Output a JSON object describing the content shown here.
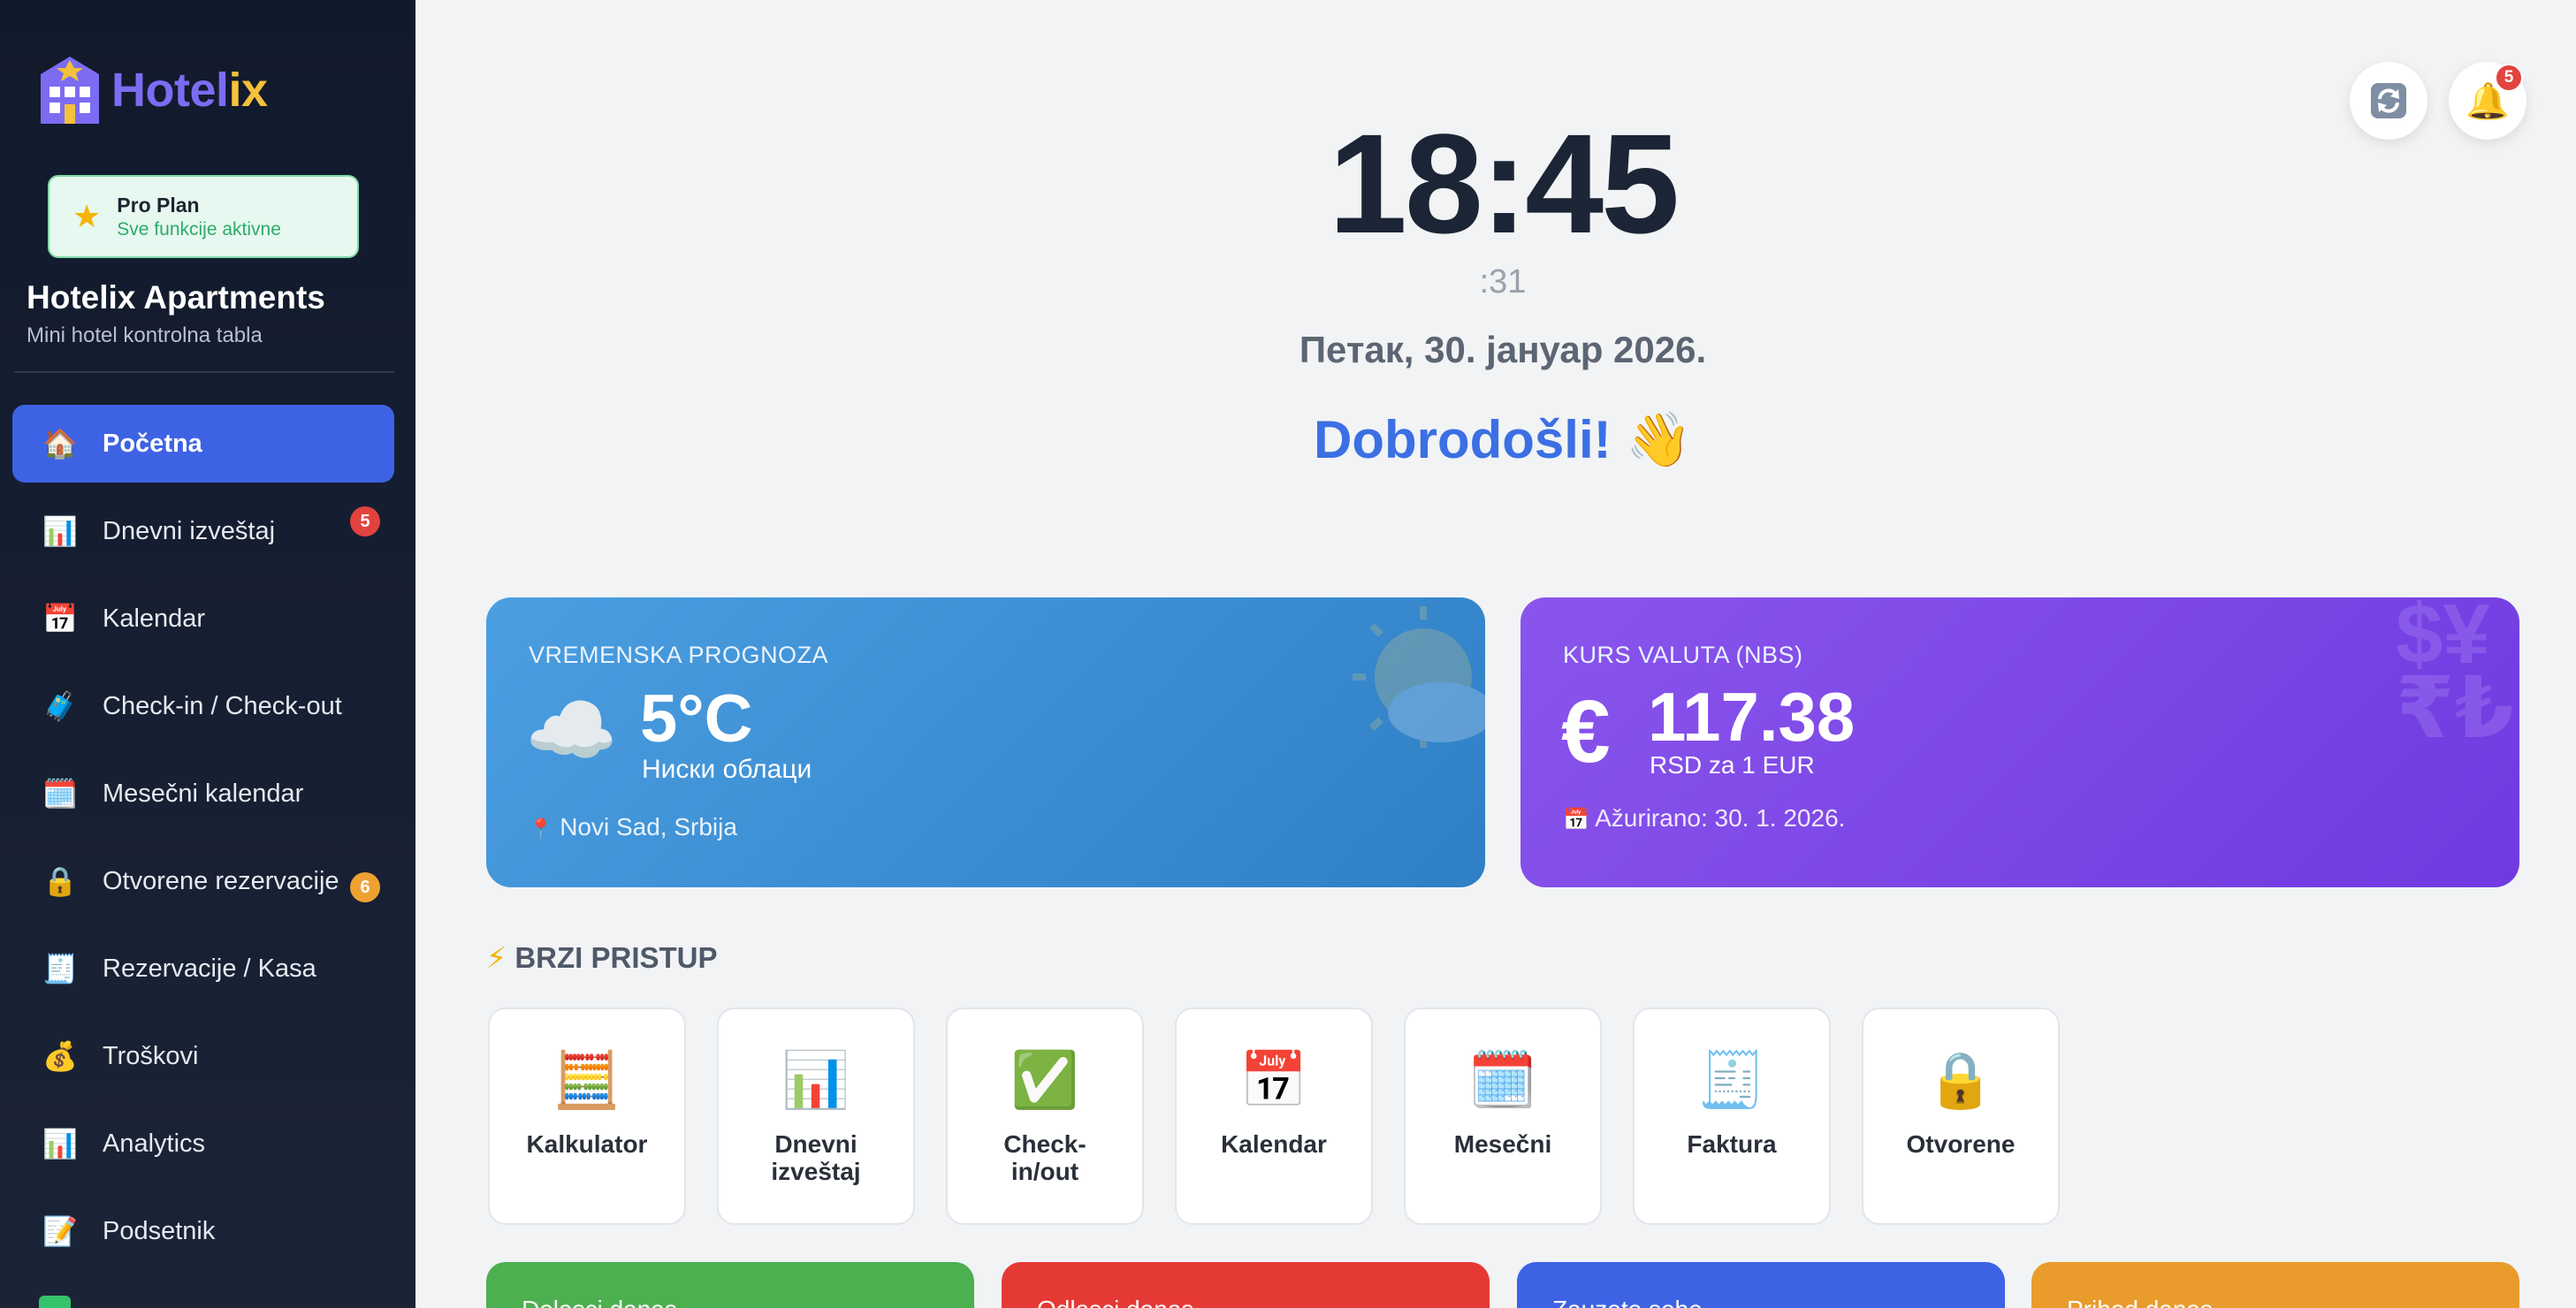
{
  "sidebar": {
    "logo": {
      "part1": "Hotel",
      "part2": "ix"
    },
    "plan": {
      "title": "Pro Plan",
      "subtitle": "Sve funkcije aktivne"
    },
    "hotel_name": "Hotelix Apartments",
    "hotel_subtitle": "Mini hotel kontrolna tabla",
    "items": [
      {
        "icon": "home-icon",
        "emoji": "🏠",
        "label": "Početna",
        "active": true
      },
      {
        "icon": "bar-chart-icon",
        "emoji": "📊",
        "label": "Dnevni izveštaj",
        "badge": "5"
      },
      {
        "icon": "calendar-icon",
        "emoji": "📅",
        "label": "Kalendar"
      },
      {
        "icon": "luggage-icon",
        "emoji": "🧳",
        "label": "Check-in / Check-out"
      },
      {
        "icon": "spiral-calendar-icon",
        "emoji": "🗓️",
        "label": "Mesečni kalendar"
      },
      {
        "icon": "lock-icon",
        "emoji": "🔒",
        "label": "Otvorene rezervacije",
        "badge": "6"
      },
      {
        "icon": "receipt-icon",
        "emoji": "🧾",
        "label": "Rezervacije / Kasa"
      },
      {
        "icon": "money-bag-icon",
        "emoji": "💰",
        "label": "Troškovi"
      },
      {
        "icon": "analytics-icon",
        "emoji": "📊",
        "label": "Analytics"
      },
      {
        "icon": "memo-icon",
        "emoji": "📝",
        "label": "Podsetnik"
      }
    ]
  },
  "header": {
    "refresh_icon": "refresh-icon",
    "bell_icon": "bell-icon",
    "notifications_count": "5"
  },
  "clock": {
    "time": "18:45",
    "seconds": ":31",
    "date": "Петак, 30. јануар 2026.",
    "welcome": "Dobrodošli! 👋"
  },
  "weather": {
    "label": "VREMENSKA PROGNOZA",
    "icon": "cloud-icon",
    "temperature": "5°C",
    "condition": "Ниски облаци",
    "location": "Novi Sad, Srbija"
  },
  "exchange": {
    "label": "KURS VALUTA (NBS)",
    "symbol": "€",
    "rate": "117.38",
    "unit": "RSD za 1 EUR",
    "updated": "Ažurirano: 30. 1. 2026."
  },
  "quick_access": {
    "title": "BRZI PRISTUP",
    "title_icon": "lightning-icon",
    "tiles": [
      {
        "icon": "abacus-icon",
        "emoji": "🧮",
        "label": "Kalkulator"
      },
      {
        "icon": "bar-chart-icon",
        "emoji": "📊",
        "label": "Dnevni izveštaj"
      },
      {
        "icon": "check-mark-icon",
        "emoji": "✅",
        "label": "Check-in/out"
      },
      {
        "icon": "calendar-icon",
        "emoji": "📅",
        "label": "Kalendar"
      },
      {
        "icon": "spiral-calendar-icon",
        "emoji": "🗓️",
        "label": "Mesečni"
      },
      {
        "icon": "receipt-icon",
        "emoji": "🧾",
        "label": "Faktura"
      },
      {
        "icon": "lock-icon",
        "emoji": "🔒",
        "label": "Otvorene"
      }
    ]
  },
  "stats": [
    {
      "label": "Dolasci danas",
      "color": "#4caf50"
    },
    {
      "label": "Odlasci danas",
      "color": "#e53935"
    },
    {
      "label": "Zauzete sobe",
      "color": "#3d63e4"
    },
    {
      "label": "Prihod danas",
      "color": "#e99b2c"
    }
  ],
  "colors": {
    "accent": "#3d63e4",
    "sidebar_bg": "#111a2c",
    "weather_card": "#4294d8",
    "fx_card": "#7d48e6",
    "badge_red": "#e2433f",
    "badge_orange": "#eea232"
  }
}
